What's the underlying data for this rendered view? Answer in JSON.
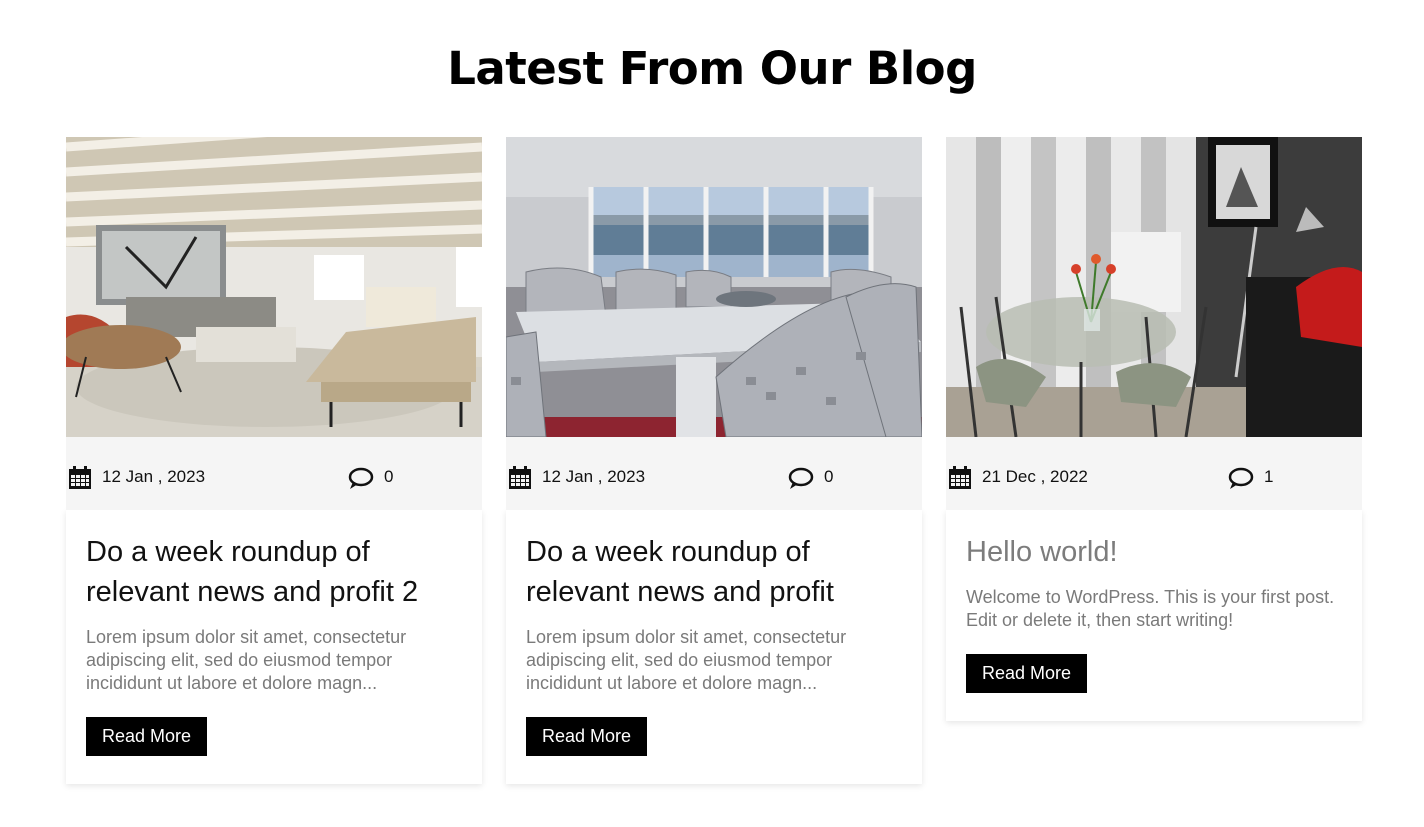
{
  "section": {
    "title": "Latest From Our Blog"
  },
  "posts": [
    {
      "date": "12 Jan , 2023",
      "comments": "0",
      "title_line1": "Do a week roundup of",
      "title_line2": "relevant news and profit 2",
      "excerpt_line1": "Lorem ipsum dolor sit amet, consectetur",
      "excerpt_line2": "adipiscing elit, sed do eiusmod tempor",
      "excerpt_line3": "incididunt ut labore et dolore magn...",
      "button": "Read More",
      "image": "living-room-photo"
    },
    {
      "date": "12 Jan , 2023",
      "comments": "0",
      "title_line1": "Do a week roundup of",
      "title_line2": "relevant news and profit",
      "excerpt_line1": "Lorem ipsum dolor sit amet, consectetur",
      "excerpt_line2": "adipiscing elit, sed do eiusmod tempor",
      "excerpt_line3": "incididunt ut labore et dolore magn...",
      "button": "Read More",
      "image": "dining-room-photo"
    },
    {
      "date": "21 Dec , 2022",
      "comments": "1",
      "title_line1": "Hello world!",
      "excerpt_line1": "Welcome to WordPress. This is your first post.",
      "excerpt_line2": "Edit or delete it, then start writing!",
      "button": "Read More",
      "image": "dining-nook-photo"
    }
  ],
  "icons": {
    "date": "calendar-icon",
    "comments": "comment-bubble-icon"
  },
  "colors": {
    "meta_bg": "#f5f5f5",
    "button_bg": "#000000",
    "excerpt": "#7a7a7a"
  }
}
